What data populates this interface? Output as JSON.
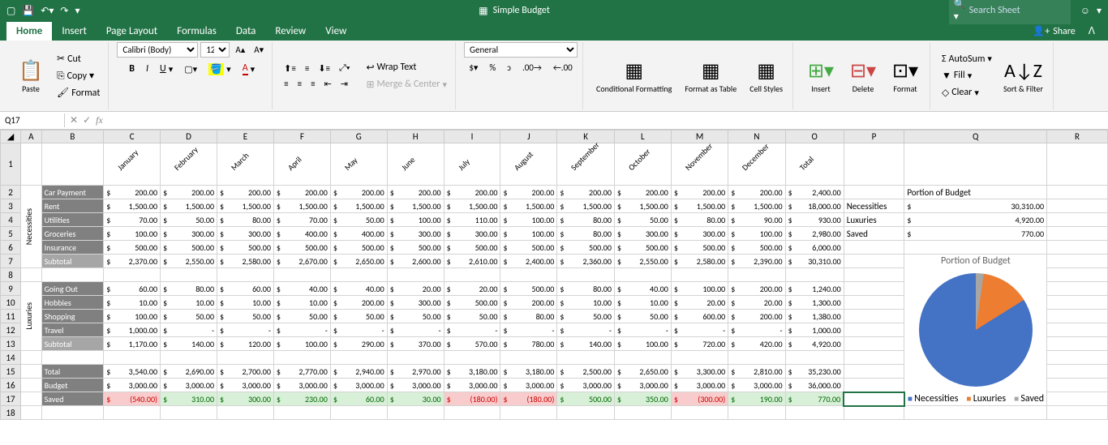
{
  "title": "Simple Budget",
  "search_placeholder": "Search Sheet",
  "tabs": [
    "Home",
    "Insert",
    "Page Layout",
    "Formulas",
    "Data",
    "Review",
    "View"
  ],
  "share": "Share",
  "clipboard": {
    "paste": "Paste",
    "cut": "Cut",
    "copy": "Copy",
    "format": "Format"
  },
  "font": {
    "name": "Calibri (Body)",
    "size": "12"
  },
  "align": {
    "wrap": "Wrap Text",
    "merge": "Merge & Center"
  },
  "number": {
    "format": "General"
  },
  "styles": {
    "cond": "Conditional\nFormatting",
    "table": "Format\nas Table",
    "cell": "Cell\nStyles"
  },
  "cells": {
    "insert": "Insert",
    "delete": "Delete",
    "format": "Format"
  },
  "editing": {
    "autosum": "AutoSum",
    "fill": "Fill",
    "clear": "Clear",
    "sort": "Sort &\nFilter"
  },
  "namebox": "Q17",
  "cols": [
    "A",
    "B",
    "C",
    "D",
    "E",
    "F",
    "G",
    "H",
    "I",
    "J",
    "K",
    "L",
    "M",
    "N",
    "O",
    "P",
    "Q",
    "R"
  ],
  "months": [
    "January",
    "February",
    "March",
    "April",
    "May",
    "June",
    "July",
    "August",
    "September",
    "October",
    "November",
    "December",
    "Total"
  ],
  "cat_necessities": "Necessities",
  "cat_luxuries": "Luxuries",
  "rows": {
    "car": {
      "label": "Car Payment",
      "v": [
        "200.00",
        "200.00",
        "200.00",
        "200.00",
        "200.00",
        "200.00",
        "200.00",
        "200.00",
        "200.00",
        "200.00",
        "200.00",
        "200.00",
        "2,400.00"
      ]
    },
    "rent": {
      "label": "Rent",
      "v": [
        "1,500.00",
        "1,500.00",
        "1,500.00",
        "1,500.00",
        "1,500.00",
        "1,500.00",
        "1,500.00",
        "1,500.00",
        "1,500.00",
        "1,500.00",
        "1,500.00",
        "1,500.00",
        "18,000.00"
      ]
    },
    "util": {
      "label": "Utilities",
      "v": [
        "70.00",
        "50.00",
        "80.00",
        "70.00",
        "50.00",
        "100.00",
        "110.00",
        "100.00",
        "80.00",
        "50.00",
        "80.00",
        "90.00",
        "930.00"
      ]
    },
    "groc": {
      "label": "Groceries",
      "v": [
        "100.00",
        "300.00",
        "300.00",
        "400.00",
        "400.00",
        "300.00",
        "300.00",
        "100.00",
        "80.00",
        "300.00",
        "300.00",
        "100.00",
        "2,980.00"
      ]
    },
    "ins": {
      "label": "Insurance",
      "v": [
        "500.00",
        "500.00",
        "500.00",
        "500.00",
        "500.00",
        "500.00",
        "500.00",
        "500.00",
        "500.00",
        "500.00",
        "500.00",
        "500.00",
        "6,000.00"
      ]
    },
    "nsub": {
      "label": "Subtotal",
      "v": [
        "2,370.00",
        "2,550.00",
        "2,580.00",
        "2,670.00",
        "2,650.00",
        "2,600.00",
        "2,610.00",
        "2,400.00",
        "2,360.00",
        "2,550.00",
        "2,580.00",
        "2,390.00",
        "30,310.00"
      ]
    },
    "go": {
      "label": "Going Out",
      "v": [
        "60.00",
        "80.00",
        "60.00",
        "40.00",
        "40.00",
        "20.00",
        "20.00",
        "500.00",
        "80.00",
        "40.00",
        "100.00",
        "200.00",
        "1,240.00"
      ]
    },
    "hob": {
      "label": "Hobbies",
      "v": [
        "10.00",
        "10.00",
        "10.00",
        "10.00",
        "200.00",
        "300.00",
        "500.00",
        "200.00",
        "10.00",
        "10.00",
        "20.00",
        "20.00",
        "1,300.00"
      ]
    },
    "shop": {
      "label": "Shopping",
      "v": [
        "100.00",
        "50.00",
        "50.00",
        "50.00",
        "50.00",
        "50.00",
        "50.00",
        "80.00",
        "50.00",
        "50.00",
        "600.00",
        "200.00",
        "1,380.00"
      ]
    },
    "trav": {
      "label": "Travel",
      "v": [
        "1,000.00",
        "-",
        "-",
        "-",
        "-",
        "-",
        "-",
        "-",
        "-",
        "-",
        "-",
        "-",
        "1,000.00"
      ]
    },
    "lsub": {
      "label": "Subtotal",
      "v": [
        "1,170.00",
        "140.00",
        "120.00",
        "100.00",
        "290.00",
        "370.00",
        "570.00",
        "780.00",
        "140.00",
        "100.00",
        "720.00",
        "420.00",
        "4,920.00"
      ]
    },
    "tot": {
      "label": "Total",
      "v": [
        "3,540.00",
        "2,690.00",
        "2,700.00",
        "2,770.00",
        "2,940.00",
        "2,970.00",
        "3,180.00",
        "3,180.00",
        "2,500.00",
        "2,650.00",
        "3,300.00",
        "2,810.00",
        "35,230.00"
      ]
    },
    "bud": {
      "label": "Budget",
      "v": [
        "3,000.00",
        "3,000.00",
        "3,000.00",
        "3,000.00",
        "3,000.00",
        "3,000.00",
        "3,000.00",
        "3,000.00",
        "3,000.00",
        "3,000.00",
        "3,000.00",
        "3,000.00",
        "36,000.00"
      ]
    },
    "sav": {
      "label": "Saved",
      "v": [
        "(540.00)",
        "310.00",
        "300.00",
        "230.00",
        "60.00",
        "30.00",
        "(180.00)",
        "(180.00)",
        "500.00",
        "350.00",
        "(300.00)",
        "190.00",
        "770.00"
      ]
    }
  },
  "portion": {
    "title": "Portion of Budget",
    "chart_title": "Portion of Budget",
    "necessities": {
      "label": "Necessities",
      "value": "30,310.00"
    },
    "luxuries": {
      "label": "Luxuries",
      "value": "4,920.00"
    },
    "saved": {
      "label": "Saved",
      "value": "770.00"
    }
  },
  "chart_data": {
    "type": "pie",
    "title": "Portion of Budget",
    "categories": [
      "Necessities",
      "Luxuries",
      "Saved"
    ],
    "values": [
      30310,
      4920,
      770
    ]
  }
}
